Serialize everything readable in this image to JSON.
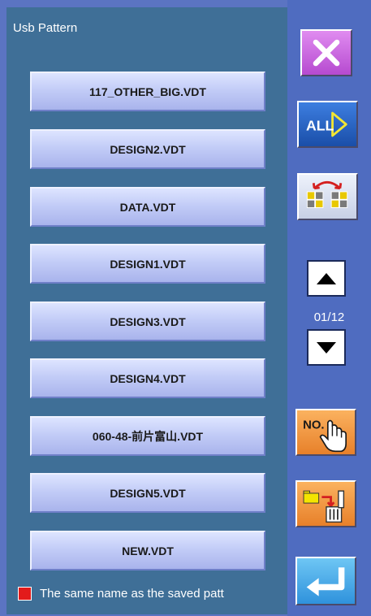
{
  "title": "Usb Pattern",
  "files": [
    "117_OTHER_BIG.VDT",
    "DESIGN2.VDT",
    "DATA.VDT",
    "DESIGN1.VDT",
    "DESIGN3.VDT",
    "DESIGN4.VDT",
    "060-48-前片富山.VDT",
    "DESIGN5.VDT",
    "NEW.VDT"
  ],
  "page": "01/12",
  "legend": "The same name as the saved patt",
  "buttons": {
    "close": {
      "icon": "close-icon"
    },
    "all": {
      "label": "ALL",
      "icon": "all-arrow-icon"
    },
    "exchange": {
      "icon": "swap-patterns-icon"
    },
    "page_up": {
      "icon": "triangle-up-icon"
    },
    "page_down": {
      "icon": "triangle-down-icon"
    },
    "number": {
      "label": "NO.",
      "icon": "hand-pointer-icon"
    },
    "delete": {
      "icon": "folder-to-trash-icon"
    },
    "enter": {
      "icon": "return-arrow-icon"
    }
  },
  "colors": {
    "legend_marker": "#e31b1b",
    "close_button": "#c25ad6",
    "all_button": "#2a62c6",
    "number_button": "#f09a43",
    "enter_button": "#3aa7e8"
  }
}
